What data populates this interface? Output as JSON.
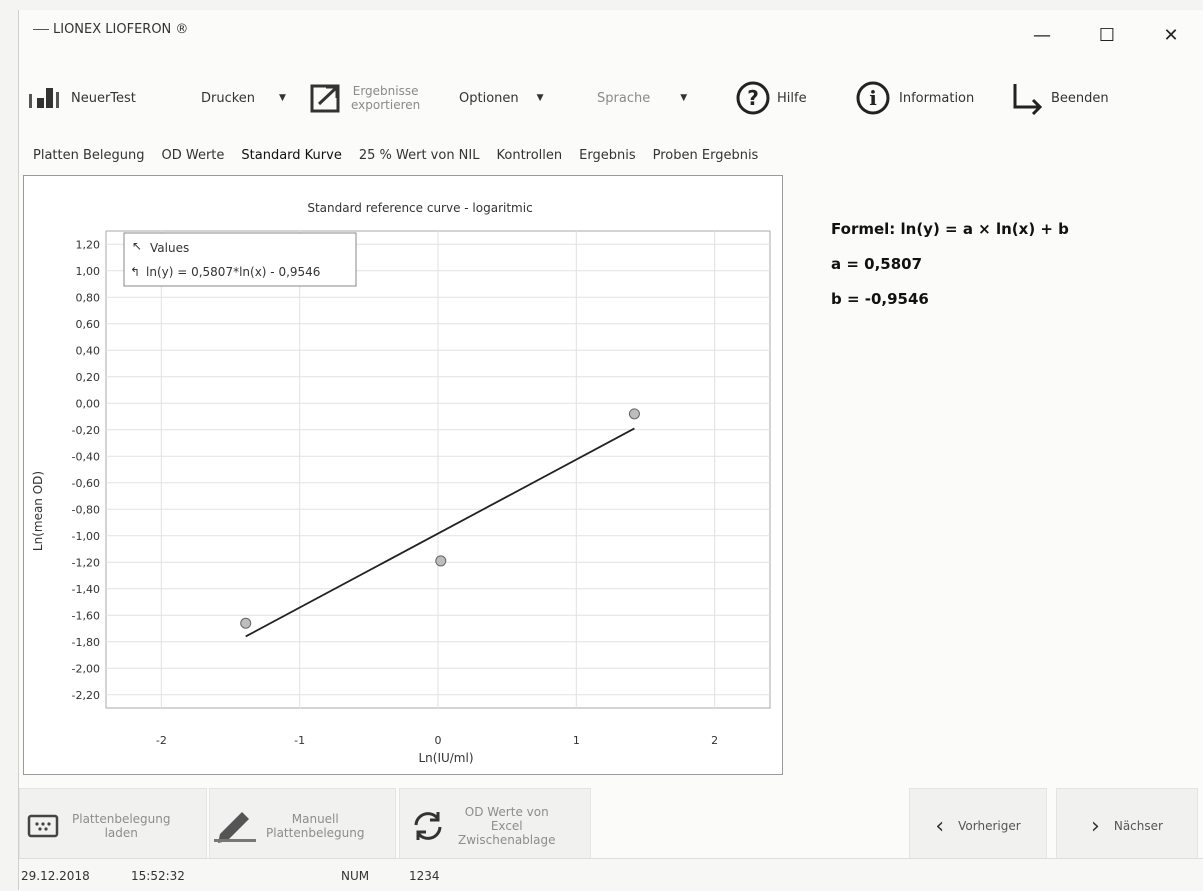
{
  "window": {
    "title": "LIONEX LIOFERON ®",
    "minimize": "—",
    "maximize": "☐",
    "close": "✕"
  },
  "toolbar": {
    "new_test": "NeuerTest",
    "print": "Drucken",
    "export_line1": "Ergebnisse",
    "export_line2": "exportieren",
    "options": "Optionen",
    "language": "Sprache",
    "help": "Hilfe",
    "information": "Information",
    "quit": "Beenden"
  },
  "tabs": [
    "Platten Belegung",
    "OD Werte",
    "Standard Kurve",
    "25 % Wert von NIL",
    "Kontrollen",
    "Ergebnis",
    "Proben Ergebnis"
  ],
  "active_tab": "Standard Kurve",
  "formula": {
    "text": "Formel: ln(y) = a × ln(x) + b",
    "a": "a = 0,5807",
    "b": "b = -0,9546"
  },
  "chart_data": {
    "type": "scatter",
    "title": "Standard reference curve - logaritmic",
    "xlabel": "Ln(IU/ml)",
    "ylabel": "Ln(mean OD)",
    "xlim": [
      -2.4,
      2.4
    ],
    "ylim": [
      -2.3,
      1.3
    ],
    "x_ticks": [
      "-2",
      "-1",
      "0",
      "1",
      "2"
    ],
    "y_ticks": [
      "1,20",
      "1,00",
      "0,80",
      "0,60",
      "0,40",
      "0,20",
      "0,00",
      "-0,20",
      "-0,40",
      "-0,60",
      "-0,80",
      "-1,00",
      "-1,20",
      "-1,40",
      "-1,60",
      "-1,80",
      "-2,00",
      "-2,20"
    ],
    "grid": true,
    "legend": [
      "Values",
      "ln(y) = 0,5807*ln(x) - 0,9546"
    ],
    "legend_position": "top-left",
    "series": [
      {
        "name": "Values",
        "kind": "points",
        "x": [
          -1.39,
          0.02,
          1.42
        ],
        "y": [
          -1.66,
          -1.19,
          -0.08
        ]
      },
      {
        "name": "ln(y) = 0,5807*ln(x) - 0,9546",
        "kind": "line",
        "x": [
          -1.39,
          1.42
        ],
        "y": [
          -1.76,
          -0.19
        ]
      }
    ]
  },
  "bottom": {
    "load_line1": "Plattenbelegung",
    "load_line2": "laden",
    "manual_line1": "Manuell",
    "manual_line2": "Plattenbelegung",
    "od_line1": "OD Werte von",
    "od_line2": "Excel",
    "od_line3": "Zwischenablage",
    "prev": "Vorheriger",
    "next": "Nächser"
  },
  "status": {
    "date": "29.12.2018",
    "time": "15:52:32",
    "num": "NUM",
    "code": "1234"
  }
}
